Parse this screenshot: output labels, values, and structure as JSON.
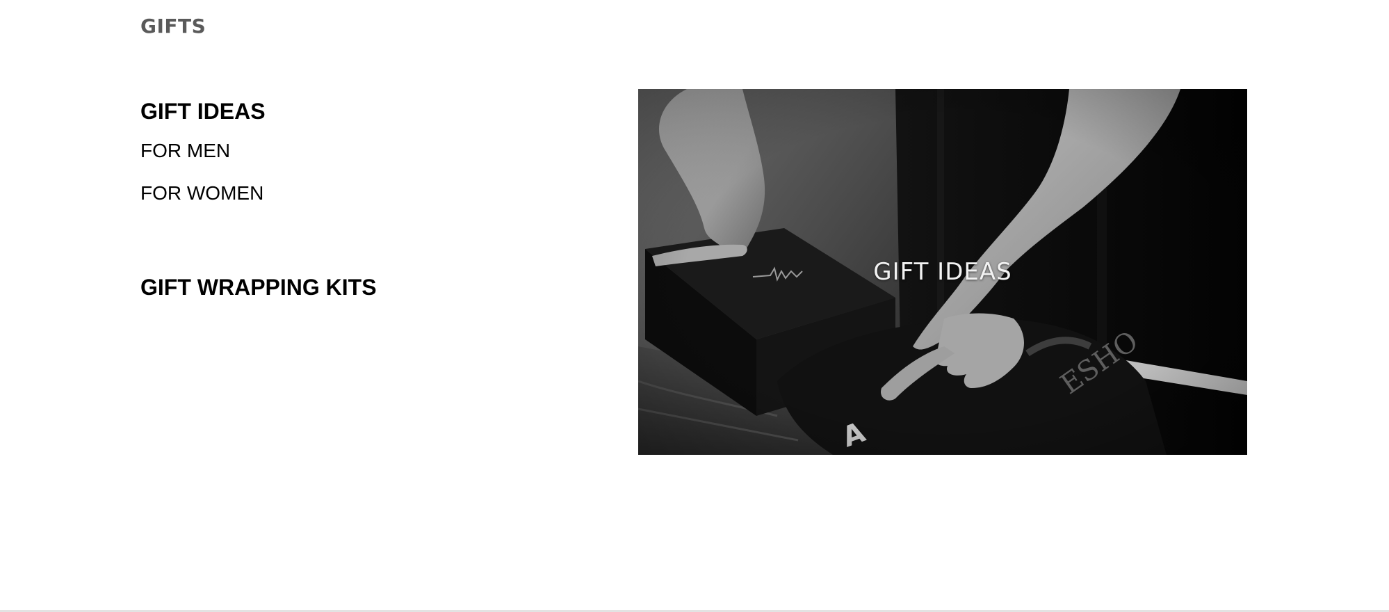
{
  "section": {
    "title": "GIFTS"
  },
  "menu": {
    "groups": [
      {
        "heading": "GIFT IDEAS",
        "links": [
          "FOR MEN",
          "FOR WOMEN"
        ]
      },
      {
        "heading": "GIFT WRAPPING KITS",
        "links": []
      }
    ]
  },
  "promo": {
    "label": "GIFT IDEAS",
    "image": "black-and-white photo of hands wrapping a black gift box in fabric",
    "colors": {
      "overlay_text": "#f2f2f2",
      "background": "#0a0a0a"
    }
  }
}
